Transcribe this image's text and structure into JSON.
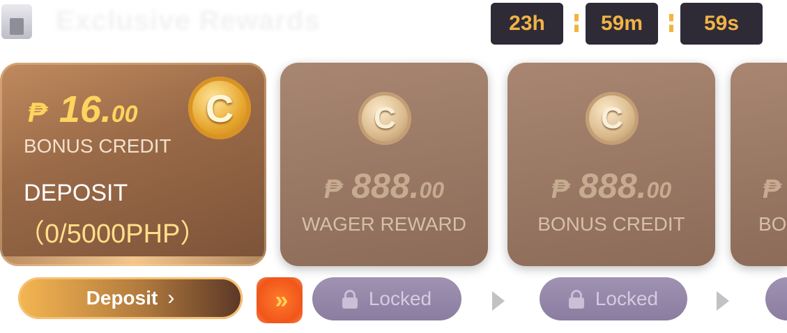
{
  "header": {
    "title": "Exclusive Rewards",
    "timer": {
      "hours": "23h",
      "minutes": "59m",
      "seconds": "59s"
    }
  },
  "cards": [
    {
      "state": "active",
      "currency": "₱",
      "amount_int": "16.",
      "amount_dec": "00",
      "label": "BONUS CREDIT",
      "requirement": "DEPOSIT",
      "progress": "（0/5000PHP）",
      "coin_letter": "C",
      "button_label": "Deposit",
      "button_icon": "chevron-right-icon"
    },
    {
      "state": "locked",
      "currency": "₱",
      "amount_int": "888.",
      "amount_dec": "00",
      "label": "WAGER REWARD",
      "coin_letter": "C",
      "button_label": "Locked",
      "button_icon": "lock-icon"
    },
    {
      "state": "locked",
      "currency": "₱",
      "amount_int": "888.",
      "amount_dec": "00",
      "label": "BONUS CREDIT",
      "coin_letter": "C",
      "button_label": "Locked",
      "button_icon": "lock-icon"
    },
    {
      "state": "locked",
      "currency": "₱",
      "label": "BO"
    }
  ],
  "connector_icon": "fast-forward-icon",
  "colors": {
    "accent_gold": "#ffd45e",
    "timer_text": "#f0b347",
    "timer_bg": "#2f2b36",
    "locked_pill": "#9f92b2",
    "fast_forward": "#f0561a"
  }
}
